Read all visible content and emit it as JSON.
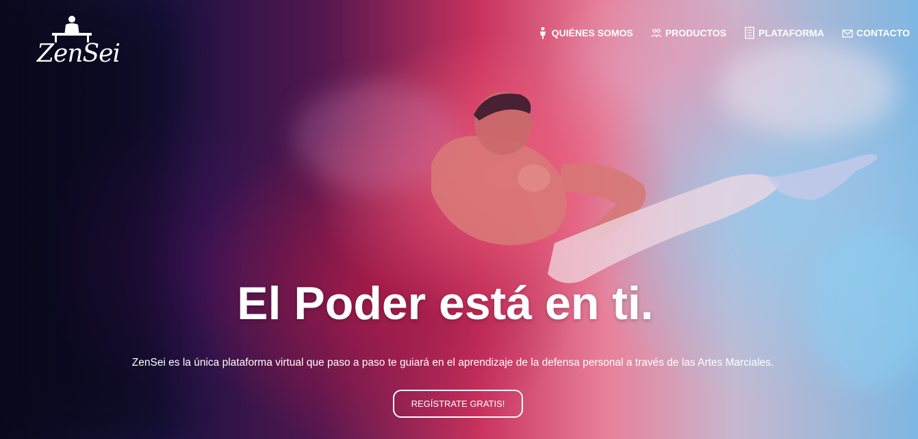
{
  "brand": {
    "logo_text": "ZenSei",
    "logo_icon": "meditating-person-icon"
  },
  "nav": {
    "items": [
      {
        "label": "QUIÉNES SOMOS",
        "icon": "martial-artist-icon"
      },
      {
        "label": "PRODUCTOS",
        "icon": "team-people-icon"
      },
      {
        "label": "PLATAFORMA",
        "icon": "document-icon"
      },
      {
        "label": "CONTACTO",
        "icon": "envelope-icon"
      }
    ]
  },
  "hero": {
    "headline": "El Poder está en ti.",
    "subtitle": "ZenSei es la única plataforma virtual que paso a paso te guiará en el aprendizaje de la defensa personal a través de las Artes Marciales.",
    "cta_label": "REGÍSTRATE GRATIS!"
  },
  "colors": {
    "text": "#ffffff",
    "bg_dark": "#0b0a1e",
    "bg_magenta": "#c8325e",
    "bg_blue": "#7fb7e2"
  }
}
